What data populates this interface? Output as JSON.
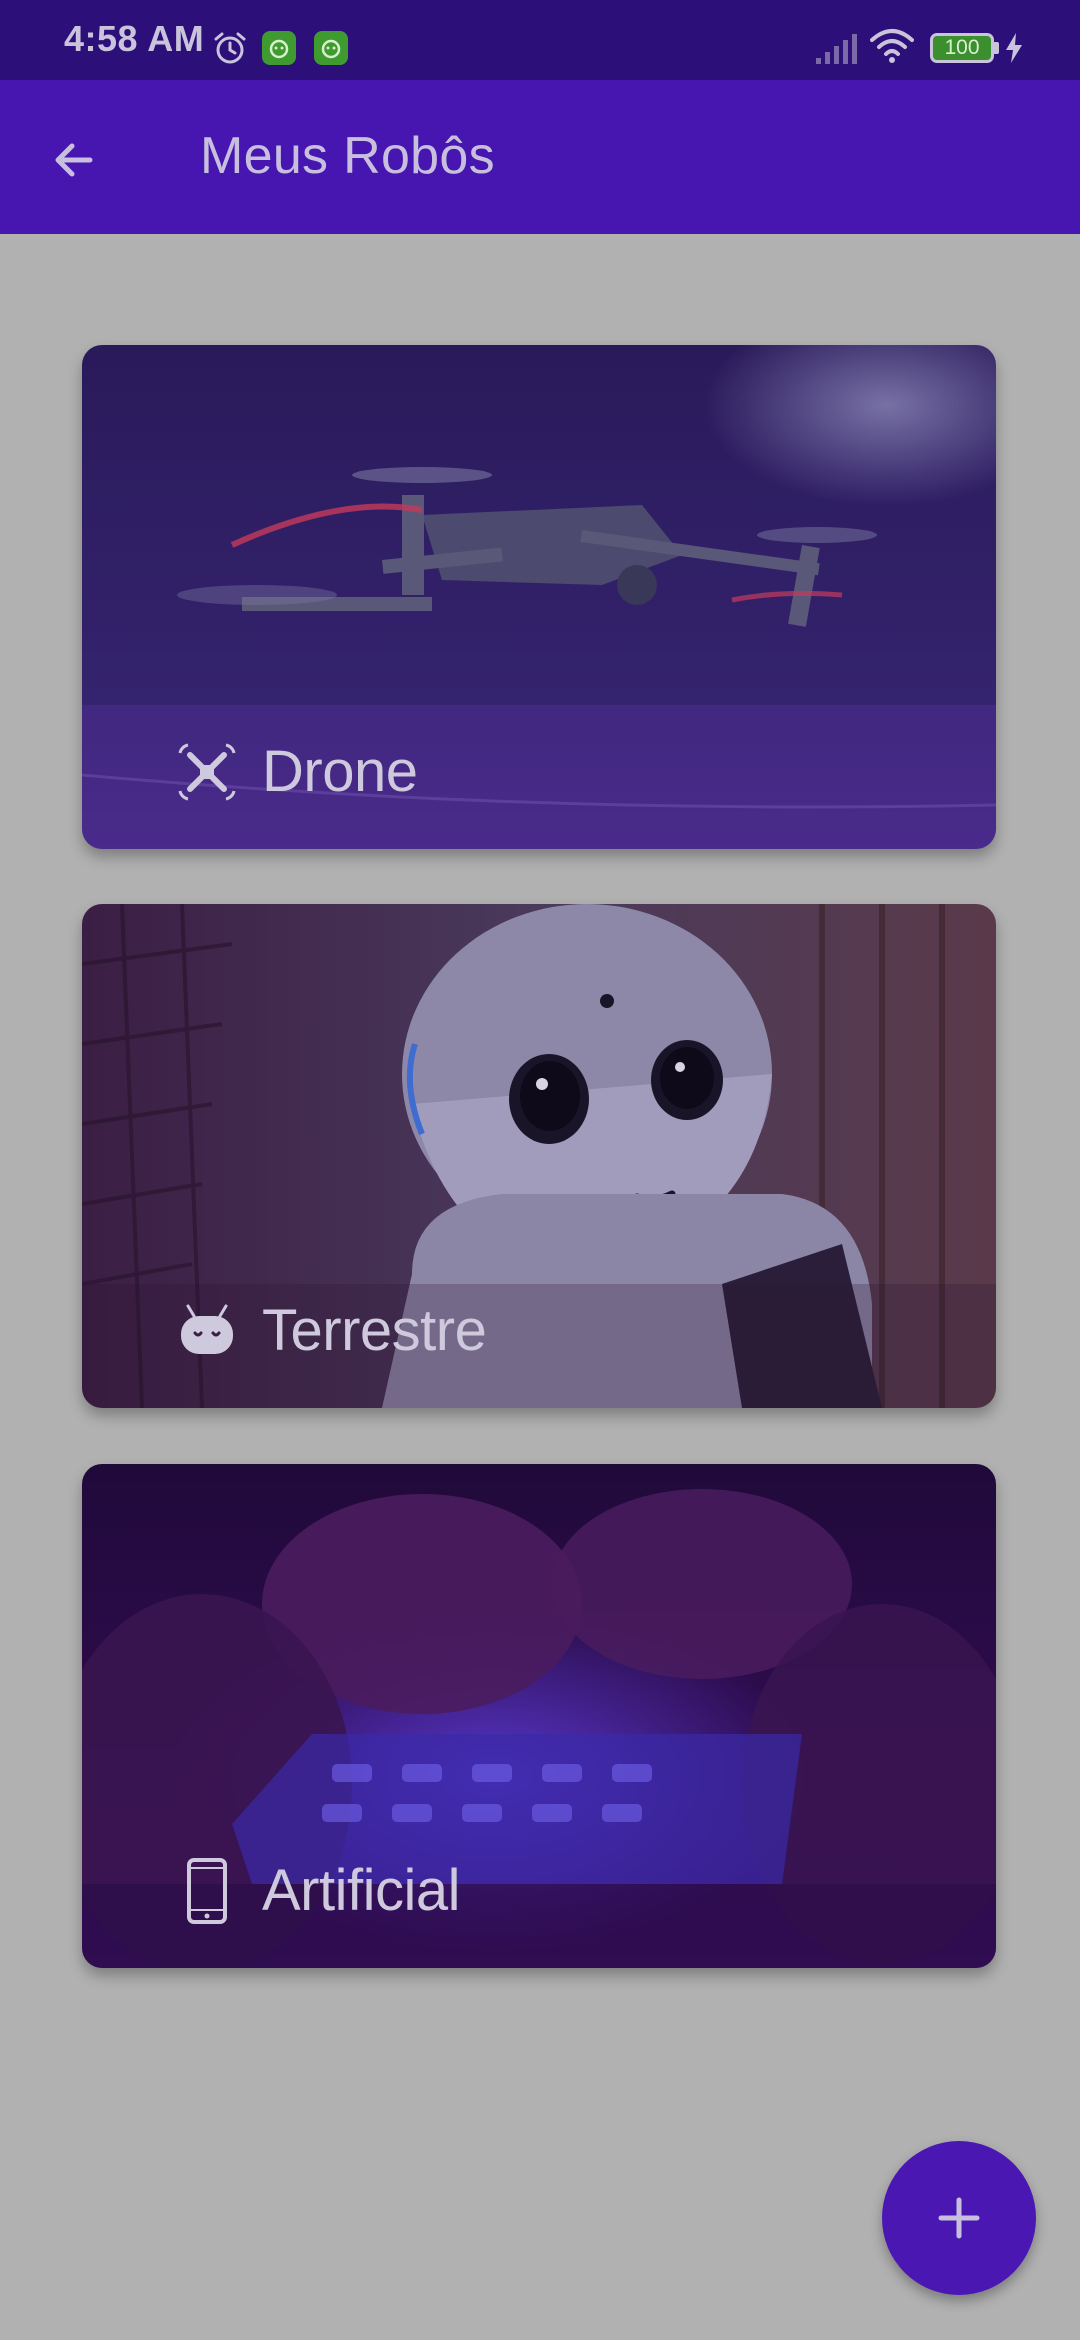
{
  "status_bar": {
    "time": "4:58 AM",
    "battery_level": "100",
    "icons": [
      "alarm-icon",
      "app-notification-icon",
      "app-notification-icon",
      "signal-icon",
      "wifi-icon",
      "battery-icon",
      "charging-icon"
    ]
  },
  "app_bar": {
    "title": "Meus Robôs",
    "back_icon": "arrow-back-icon"
  },
  "cards": [
    {
      "label": "Drone",
      "icon": "drone-icon"
    },
    {
      "label": "Terrestre",
      "icon": "android-robot-icon"
    },
    {
      "label": "Artificial",
      "icon": "smartphone-icon"
    }
  ],
  "fab": {
    "icon": "plus-icon"
  },
  "colors": {
    "status_bar": "#2c0f78",
    "app_bar": "#4715b0",
    "background": "#b1b1b1",
    "fab": "#4a17b3"
  }
}
